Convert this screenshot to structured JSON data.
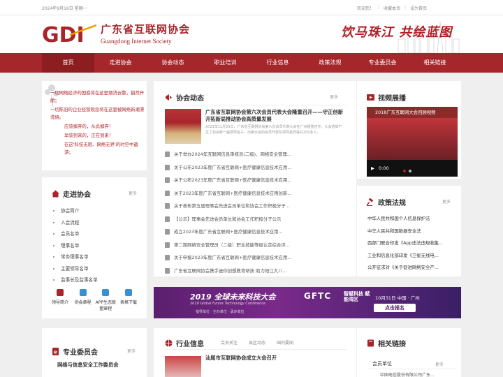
{
  "topbar": {
    "date": "2024年9月16日 星期一",
    "links": [
      "欢迎您！",
      "收藏本页",
      "设为首页"
    ]
  },
  "header": {
    "logo_mark": "GDI",
    "name_cn": "广东省互联网协会",
    "name_en": "Guangdong Internet Society",
    "slogan": "饮马珠江 共绘蓝图"
  },
  "nav": [
    "首页",
    "走进协会",
    "协会动态",
    "职业培训",
    "行业信息",
    "政策法规",
    "专业委员会",
    "相关链接"
  ],
  "poem": [
    "一切网络经济的困惑将在这里烟消云散，豁然开朗；",
    "一切陈旧的企业经营观念将在这里被网络新潮漂洗熔。",
    "应该摒弃的，从此摒弃！",
    "早该到来的，正在到来！",
    "在这'科技无限、网络无界'的时空中遨游；"
  ],
  "news": {
    "title": "协会动态",
    "more": "更多",
    "featured_title": "广东省互联网协会第六次会员代表大会隆重召开——守正创新开拓新局推动协会高质量发展",
    "featured_summary": "2023年11月25日，广东省互联网协会第六次会员代表大会在广州隆重召开，大会选举产生了协会新一届领导班子。出席大会的会员代表及领导嘉宾等共200多人。",
    "items": [
      "关于举办2024年互联网信息审核员(二级)、网络安全管理...",
      "关于公布2023年度广东省互联网+医疗健康信息技术应用...",
      "关于公布2023年度广东省互联网+医疗健康信息技术应用...",
      "关于2023年度广东省互联网+医疗健康信息技术应用创新...",
      "关于表彰第五届理事会先进会员单位和协会工作积极分子...",
      "【公示】理事会先进会员单位和协会工作积极分子公示",
      "成立2023年度广东省互联网+医疗健康信息技术应用...",
      "第二期网络安全管理员（二级）职业技能等级认定综合评...",
      "关于申报2023年度广东省互联网+医疗健康信息技术应用...",
      "广东省互联网协会携手迷你创想教育帮扶 助力阳江大八..."
    ]
  },
  "video": {
    "title": "视频展播",
    "caption": "2018广东互联网大会回顾视频",
    "time": "0:00",
    "play": "▶"
  },
  "about": {
    "title": "走进协会",
    "more": "更多",
    "items": [
      "协会简介",
      "入会流程",
      "会员名单",
      "理事名单",
      "常务理事名单",
      "主要领导名单",
      "监事长及监事名单"
    ],
    "quick": [
      "领导简介",
      "协会章程",
      "APP生态联盟章程",
      "表格下载"
    ]
  },
  "policy": {
    "title": "政策法规",
    "more": "更多",
    "items": [
      "中华人民共和国个人信息保护法",
      "中华人民共和国数据安全法",
      "西部门联合印发《App违法违规收集...",
      "工业和信息化部印发《卫星无线电...",
      "公开征求对《关于促进网络安全产..."
    ]
  },
  "ad": {
    "title": "2019 全球未来科技大会",
    "subtitle": "2019 Global Future Technology Conference",
    "brand": "GFTC",
    "tag": "智赋科技 赋能湾区",
    "date": "10月31日 中国 · 广州",
    "cta": "点击报名",
    "organizers": "指导单位 · 主办单位 · 承办单位"
  },
  "committee": {
    "title": "专业委员会",
    "more": "更多",
    "first": "网络与信息安全工作委员会"
  },
  "industry": {
    "title": "行业信息",
    "tabs": [
      "会员关注",
      "县区动态",
      "国内要闻"
    ],
    "first": "汕尾市互联网协会成立大会召开"
  },
  "links": {
    "title": "相关链接",
    "sub": "会员单位",
    "more": "更多",
    "first": "中国电信股份有限公司广东..."
  },
  "colors": {
    "brand": "#a5262b",
    "nav_active": "#8c1d21"
  }
}
